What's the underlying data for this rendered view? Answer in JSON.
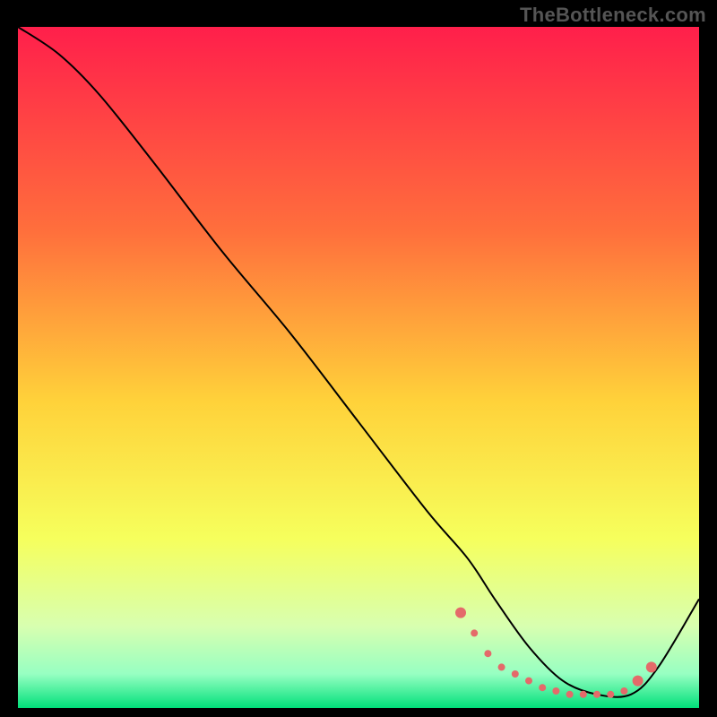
{
  "watermark": "TheBottleneck.com",
  "chart_data": {
    "type": "line",
    "title": "",
    "xlabel": "",
    "ylabel": "",
    "xlim": [
      0,
      100
    ],
    "ylim": [
      0,
      100
    ],
    "legend": false,
    "grid": false,
    "background_gradient": {
      "stops": [
        {
          "offset": 0.0,
          "color": "#ff1f4b"
        },
        {
          "offset": 0.3,
          "color": "#ff6f3c"
        },
        {
          "offset": 0.55,
          "color": "#ffd23a"
        },
        {
          "offset": 0.75,
          "color": "#f6ff5c"
        },
        {
          "offset": 0.88,
          "color": "#d8ffb0"
        },
        {
          "offset": 0.95,
          "color": "#97ffc2"
        },
        {
          "offset": 1.0,
          "color": "#00e07a"
        }
      ]
    },
    "series": [
      {
        "name": "curve",
        "color": "#000000",
        "stroke_width": 2,
        "x": [
          0,
          6,
          12,
          20,
          30,
          40,
          50,
          60,
          66,
          70,
          75,
          80,
          85,
          90,
          94,
          100
        ],
        "y": [
          100,
          96,
          90,
          80,
          67,
          55,
          42,
          29,
          22,
          16,
          9,
          4,
          2,
          2,
          6,
          16
        ]
      }
    ],
    "markers": {
      "color": "#e46a6a",
      "size_small": 4,
      "size_large": 6,
      "points": [
        {
          "x": 65,
          "y": 14,
          "r": 6
        },
        {
          "x": 67,
          "y": 11,
          "r": 4
        },
        {
          "x": 69,
          "y": 8,
          "r": 4
        },
        {
          "x": 71,
          "y": 6,
          "r": 4
        },
        {
          "x": 73,
          "y": 5,
          "r": 4
        },
        {
          "x": 75,
          "y": 4,
          "r": 4
        },
        {
          "x": 77,
          "y": 3,
          "r": 4
        },
        {
          "x": 79,
          "y": 2.5,
          "r": 4
        },
        {
          "x": 81,
          "y": 2,
          "r": 4
        },
        {
          "x": 83,
          "y": 2,
          "r": 4
        },
        {
          "x": 85,
          "y": 2,
          "r": 4
        },
        {
          "x": 87,
          "y": 2,
          "r": 4
        },
        {
          "x": 89,
          "y": 2.5,
          "r": 4
        },
        {
          "x": 91,
          "y": 4,
          "r": 6
        },
        {
          "x": 93,
          "y": 6,
          "r": 6
        }
      ]
    }
  }
}
